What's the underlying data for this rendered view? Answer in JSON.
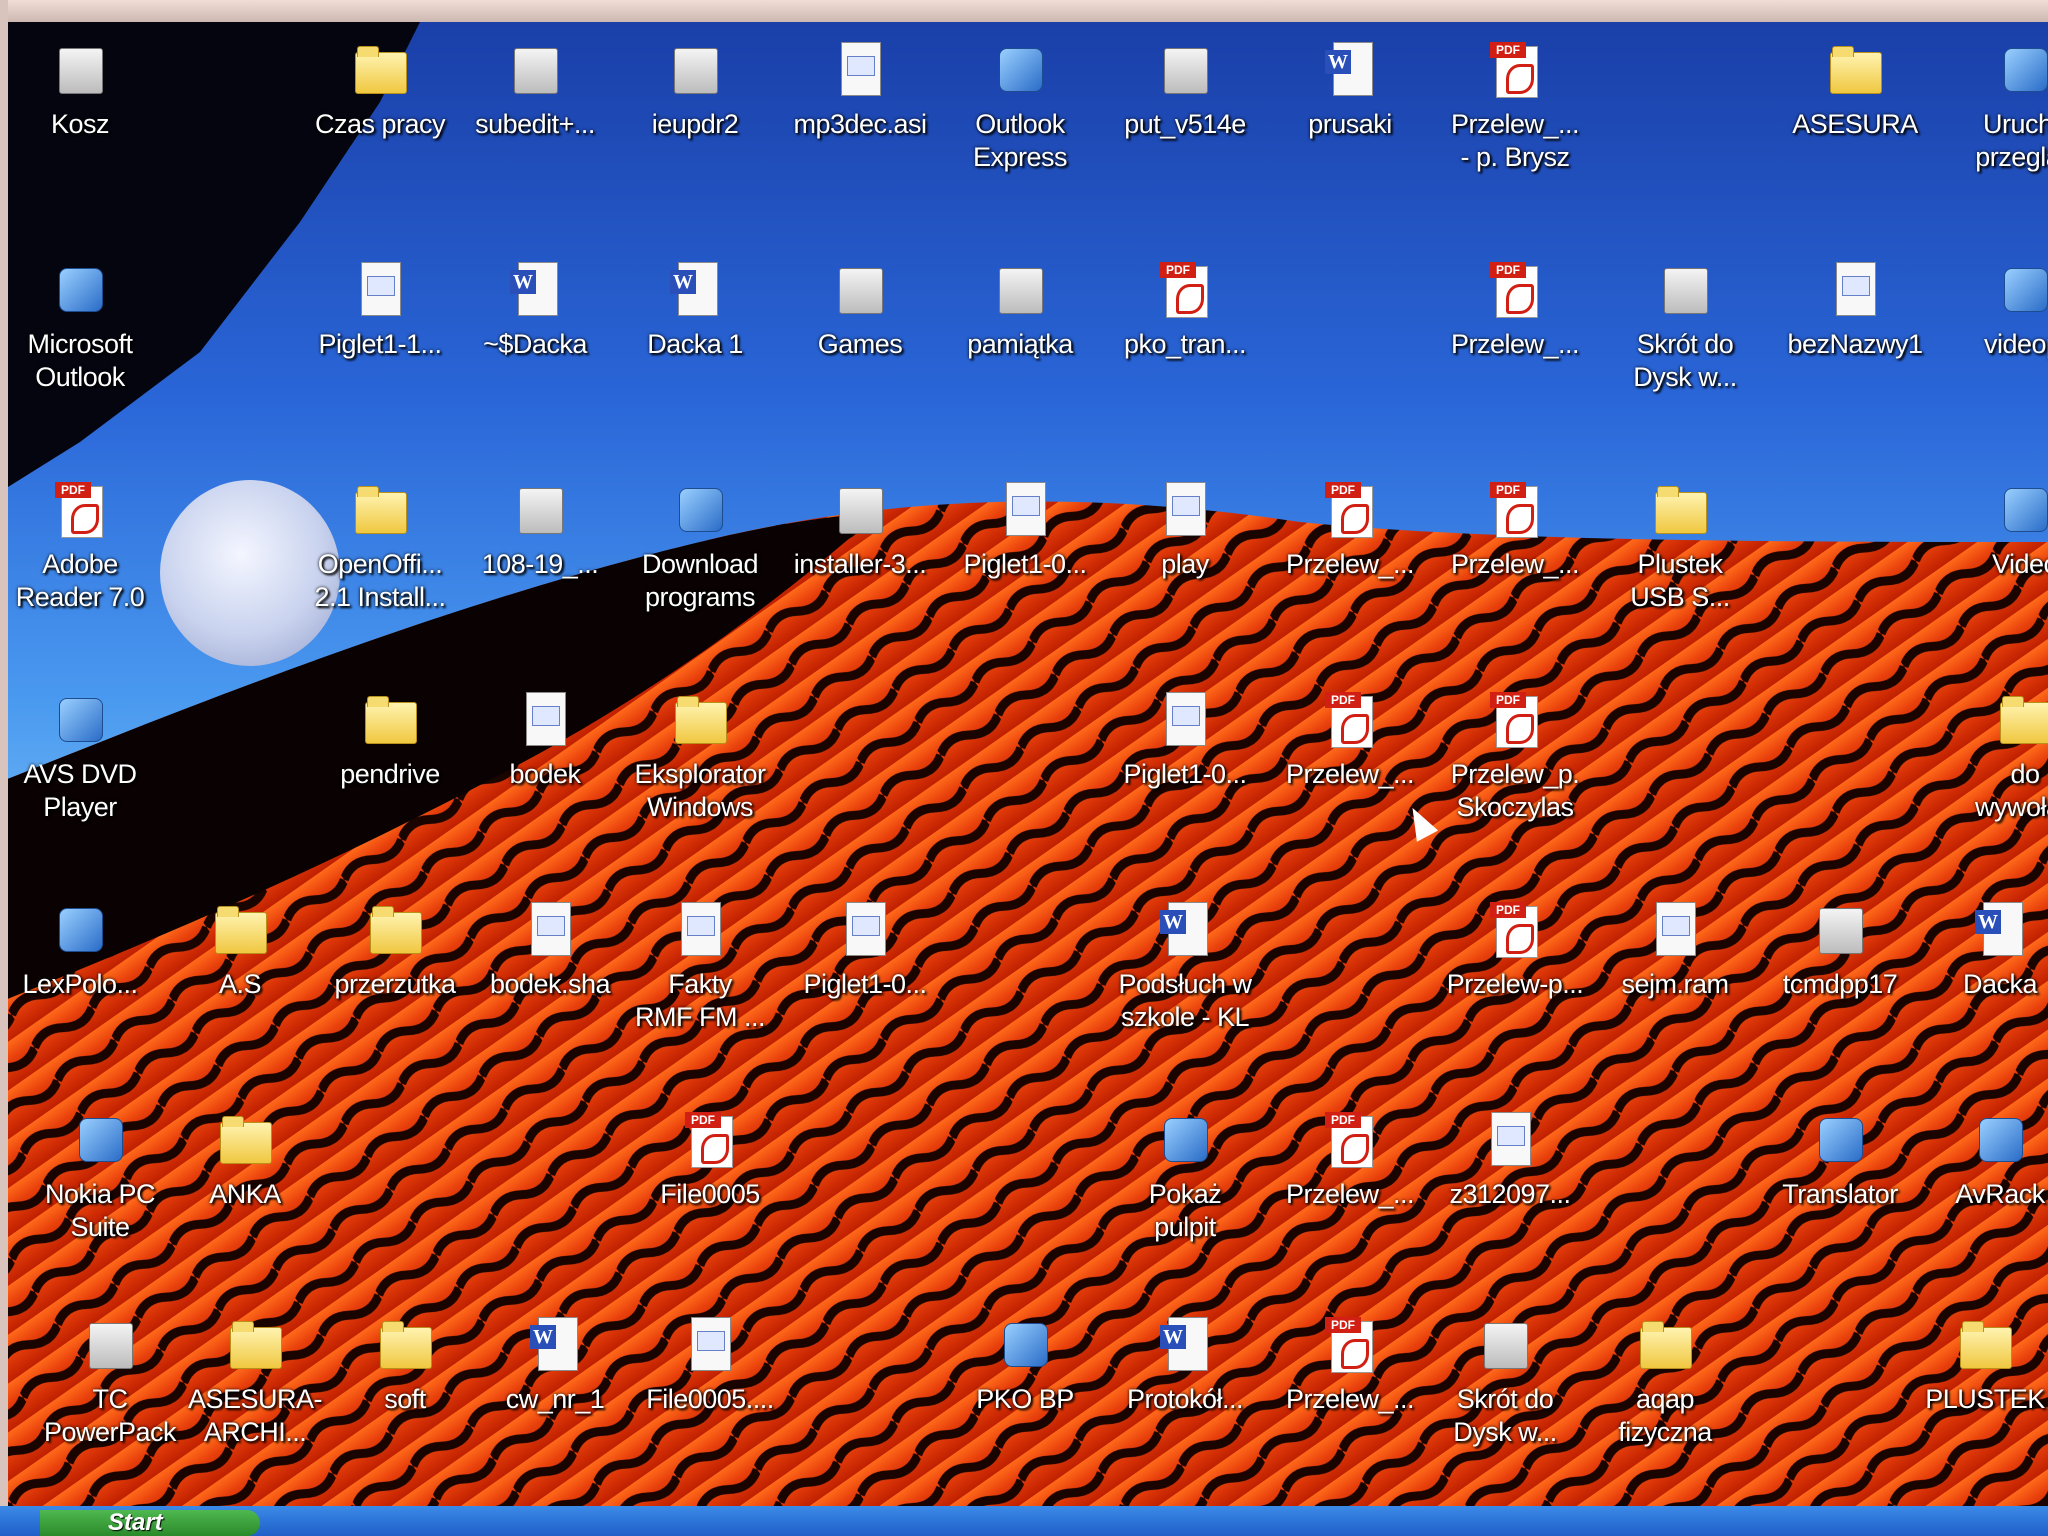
{
  "taskbar": {
    "start_label": "Start"
  },
  "icons": [
    {
      "label": "Kosz",
      "type": "generic",
      "icon_name": "recycle-bin-icon"
    },
    {
      "label": "Czas pracy",
      "type": "folder",
      "icon_name": "folder-icon"
    },
    {
      "label": "subedit+...",
      "type": "generic",
      "icon_name": "program-icon"
    },
    {
      "label": "ieupdr2",
      "type": "generic",
      "icon_name": "window-icon"
    },
    {
      "label": "mp3dec.asi",
      "type": "doc",
      "icon_name": "file-icon"
    },
    {
      "label": "Outlook\nExpress",
      "type": "app",
      "icon_name": "outlook-express-icon"
    },
    {
      "label": "put_v514e",
      "type": "generic",
      "icon_name": "archive-icon"
    },
    {
      "label": "prusaki",
      "type": "word",
      "icon_name": "word-document-icon"
    },
    {
      "label": "Przelew_...\n- p. Brysz",
      "type": "pdf",
      "icon_name": "pdf-document-icon"
    },
    {
      "label": "ASESURA",
      "type": "folder",
      "icon_name": "folder-icon"
    },
    {
      "label": "Urucho\nprzegląd",
      "type": "app",
      "icon_name": "internet-explorer-icon"
    },
    {
      "label": "Microsoft\nOutlook",
      "type": "app",
      "icon_name": "microsoft-outlook-icon"
    },
    {
      "label": "Piglet1-1...",
      "type": "doc",
      "icon_name": "file-icon"
    },
    {
      "label": "~$Dacka",
      "type": "word",
      "icon_name": "word-document-icon"
    },
    {
      "label": "Dacka 1",
      "type": "word",
      "icon_name": "word-document-icon"
    },
    {
      "label": "Games",
      "type": "generic",
      "icon_name": "games-icon"
    },
    {
      "label": "pamiątka",
      "type": "generic",
      "icon_name": "video-file-icon"
    },
    {
      "label": "pko_tran...",
      "type": "pdf",
      "icon_name": "pdf-document-icon"
    },
    {
      "label": "Przelew_...",
      "type": "pdf",
      "icon_name": "pdf-document-icon"
    },
    {
      "label": "Skrót do\nDysk w...",
      "type": "generic",
      "icon_name": "drive-shortcut-icon"
    },
    {
      "label": "bezNazwy1",
      "type": "doc",
      "icon_name": "text-document-icon"
    },
    {
      "label": "videopl",
      "type": "app",
      "icon_name": "internet-explorer-icon"
    },
    {
      "label": "Adobe\nReader 7.0",
      "type": "pdf",
      "icon_name": "adobe-reader-icon"
    },
    {
      "label": "OpenOffi...\n2.1 Install...",
      "type": "folder",
      "icon_name": "folder-icon"
    },
    {
      "label": "108-19_...",
      "type": "generic",
      "icon_name": "program-icon"
    },
    {
      "label": "Download\nprograms",
      "type": "app",
      "icon_name": "download-programs-icon"
    },
    {
      "label": "installer-3...",
      "type": "generic",
      "icon_name": "installer-icon"
    },
    {
      "label": "Piglet1-0...",
      "type": "doc",
      "icon_name": "file-icon"
    },
    {
      "label": "play",
      "type": "doc",
      "icon_name": "file-icon"
    },
    {
      "label": "Przelew_...",
      "type": "pdf",
      "icon_name": "pdf-document-icon"
    },
    {
      "label": "Przelew_...",
      "type": "pdf",
      "icon_name": "pdf-document-icon"
    },
    {
      "label": "Plustek\nUSB S...",
      "type": "folder",
      "icon_name": "plustek-folder-icon"
    },
    {
      "label": "Video",
      "type": "app",
      "icon_name": "video-play-icon"
    },
    {
      "label": "AVS DVD\nPlayer",
      "type": "app",
      "icon_name": "avs-dvd-player-icon"
    },
    {
      "label": "pendrive",
      "type": "folder",
      "icon_name": "folder-icon"
    },
    {
      "label": "bodek",
      "type": "doc",
      "icon_name": "file-icon"
    },
    {
      "label": "Eksplorator\nWindows",
      "type": "folder",
      "icon_name": "windows-explorer-icon"
    },
    {
      "label": "Piglet1-0...",
      "type": "doc",
      "icon_name": "file-icon"
    },
    {
      "label": "Przelew_...",
      "type": "pdf",
      "icon_name": "pdf-document-icon"
    },
    {
      "label": "Przelew_p.\nSkoczylas",
      "type": "pdf",
      "icon_name": "pdf-document-icon"
    },
    {
      "label": "do\nwywołan",
      "type": "folder",
      "icon_name": "folder-icon"
    },
    {
      "label": "LexPolo...",
      "type": "app",
      "icon_name": "lexpolonica-icon"
    },
    {
      "label": "A.S",
      "type": "folder",
      "icon_name": "folder-icon"
    },
    {
      "label": "przerzutka",
      "type": "folder",
      "icon_name": "folder-icon"
    },
    {
      "label": "bodek.sha",
      "type": "doc",
      "icon_name": "file-icon"
    },
    {
      "label": "Fakty\nRMF FM ...",
      "type": "doc",
      "icon_name": "audio-file-icon"
    },
    {
      "label": "Piglet1-0...",
      "type": "doc",
      "icon_name": "file-icon"
    },
    {
      "label": "Podsłuch w\nszkole - KL",
      "type": "word",
      "icon_name": "word-document-icon"
    },
    {
      "label": "Przelew-p...",
      "type": "pdf",
      "icon_name": "pdf-document-icon"
    },
    {
      "label": "sejm.ram",
      "type": "doc",
      "icon_name": "file-icon"
    },
    {
      "label": "tcmdpp17",
      "type": "generic",
      "icon_name": "program-icon"
    },
    {
      "label": "Dacka",
      "type": "word",
      "icon_name": "word-document-icon"
    },
    {
      "label": "Nokia PC\nSuite",
      "type": "app",
      "icon_name": "nokia-pc-suite-icon"
    },
    {
      "label": "ANKA",
      "type": "folder",
      "icon_name": "folder-icon"
    },
    {
      "label": "File0005",
      "type": "pdf",
      "icon_name": "pdf-document-icon"
    },
    {
      "label": "Pokaż\npulpit",
      "type": "app",
      "icon_name": "show-desktop-icon"
    },
    {
      "label": "Przelew_...",
      "type": "pdf",
      "icon_name": "pdf-document-icon"
    },
    {
      "label": "z312097...",
      "type": "doc",
      "icon_name": "image-file-icon"
    },
    {
      "label": "Translator",
      "type": "app",
      "icon_name": "translator-icon"
    },
    {
      "label": "AvRack",
      "type": "app",
      "icon_name": "avrack-icon"
    },
    {
      "label": "TC\nPowerPack",
      "type": "generic",
      "icon_name": "tc-powerpack-icon"
    },
    {
      "label": "ASESURA-\nARCHI...",
      "type": "folder",
      "icon_name": "folder-icon"
    },
    {
      "label": "soft",
      "type": "folder",
      "icon_name": "folder-icon"
    },
    {
      "label": "cw_nr_1",
      "type": "word",
      "icon_name": "word-document-icon"
    },
    {
      "label": "File0005....",
      "type": "doc",
      "icon_name": "file-icon"
    },
    {
      "label": "PKO BP",
      "type": "app",
      "icon_name": "internet-explorer-icon"
    },
    {
      "label": "Protokół...",
      "type": "word",
      "icon_name": "word-document-icon"
    },
    {
      "label": "Przelew_...",
      "type": "pdf",
      "icon_name": "pdf-document-icon"
    },
    {
      "label": "Skrót do\nDysk w...",
      "type": "generic",
      "icon_name": "drive-shortcut-icon"
    },
    {
      "label": "aqap\nfizyczna",
      "type": "folder",
      "icon_name": "folder-icon"
    },
    {
      "label": "PLUSTEK",
      "type": "folder",
      "icon_name": "folder-icon"
    }
  ]
}
